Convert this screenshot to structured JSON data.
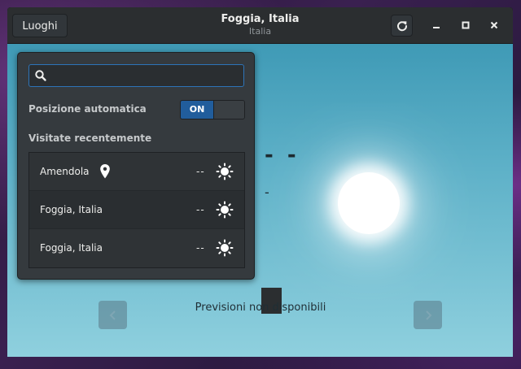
{
  "window": {
    "title": "Foggia, Italia",
    "subtitle": "Italia"
  },
  "header": {
    "places_button_label": "Luoghi",
    "refresh_icon": "refresh-icon",
    "controls": [
      "minimize-icon",
      "maximize-icon",
      "close-icon"
    ]
  },
  "popover": {
    "search": {
      "value": "",
      "placeholder": "",
      "icon": "search-icon"
    },
    "auto_location_label": "Posizione automatica",
    "auto_location_switch": "ON",
    "recent_label": "Visitate recentemente",
    "locations": [
      {
        "name": "Amendola",
        "temperature": "--",
        "weather_icon": "sun-icon",
        "current_location_icon": "map-pin-icon"
      },
      {
        "name": "Foggia, Italia",
        "temperature": "--",
        "weather_icon": "sun-icon"
      },
      {
        "name": "Foggia, Italia",
        "temperature": "--",
        "weather_icon": "sun-icon"
      }
    ]
  },
  "main": {
    "current_temperature": "- -",
    "current_condition": "-",
    "forecast_message": "Previsioni non disponibili",
    "prev_icon": "chevron-left-icon",
    "next_icon": "chevron-right-icon"
  },
  "colors": {
    "accent": "#215d9c",
    "headerbar": "#2b2e30",
    "popover": "#353a3e",
    "sky_top": "#3f9ab6",
    "sky_bottom": "#8fd0de"
  }
}
